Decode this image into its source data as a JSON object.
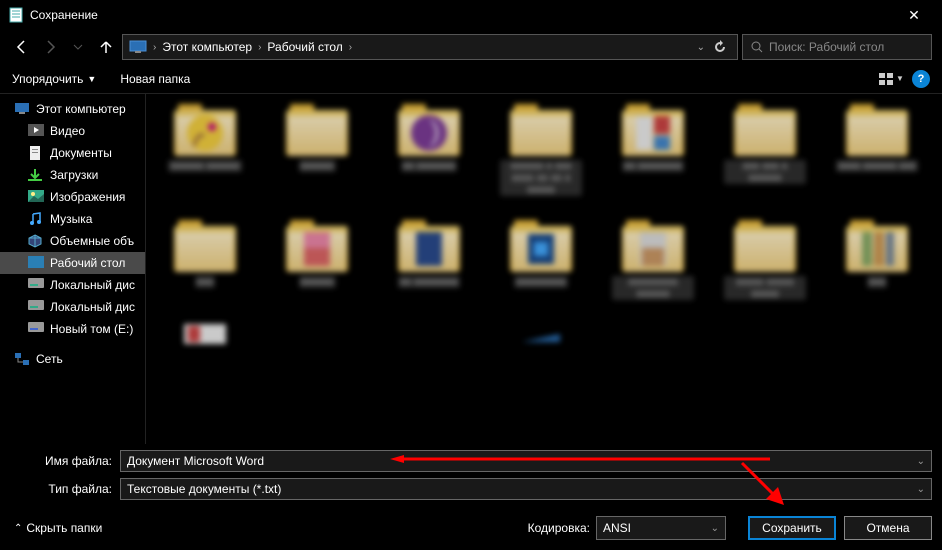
{
  "title": "Сохранение",
  "breadcrumb": {
    "pc": "Этот компьютер",
    "desktop": "Рабочий стол"
  },
  "search_placeholder": "Поиск: Рабочий стол",
  "toolbar": {
    "organize": "Упорядочить",
    "new_folder": "Новая папка",
    "help": "?"
  },
  "sidebar": {
    "this_pc": "Этот компьютер",
    "videos": "Видео",
    "documents": "Документы",
    "downloads": "Загрузки",
    "pictures": "Изображения",
    "music": "Музыка",
    "volumes": "Объемные объ",
    "desktop": "Рабочий стол",
    "local_c": "Локальный дис",
    "local_d": "Локальный дис",
    "new_vol": "Новый том (E:)",
    "network": "Сеть"
  },
  "fields": {
    "filename_label": "Имя файла:",
    "filename_value": "Документ Microsoft Word",
    "filetype_label": "Тип файла:",
    "filetype_value": "Текстовые документы (*.txt)"
  },
  "footer": {
    "hide_folders": "Скрыть папки",
    "encoding_label": "Кодировка:",
    "encoding_value": "ANSI",
    "save": "Сохранить",
    "cancel": "Отмена"
  }
}
